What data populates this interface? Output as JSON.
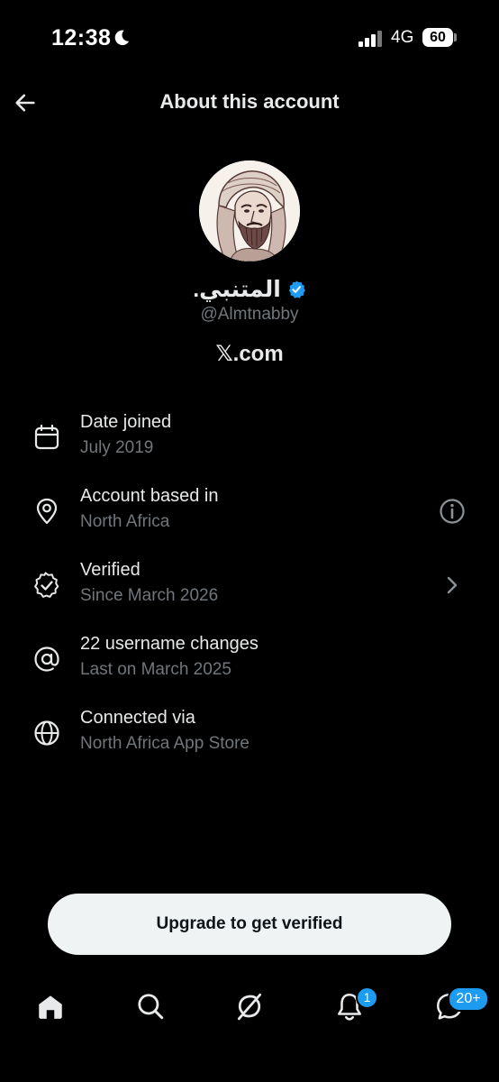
{
  "status_bar": {
    "time": "12:38",
    "network": "4G",
    "battery": "60"
  },
  "header": {
    "title": "About this account"
  },
  "profile": {
    "display_name": "المتنبي.",
    "handle": "@Almtnabby",
    "brand": "𝕏.com"
  },
  "info_rows": [
    {
      "icon": "calendar-icon",
      "title": "Date joined",
      "value": "July 2019"
    },
    {
      "icon": "location-pin-icon",
      "title": "Account based in",
      "value": "North Africa",
      "trailing": "info-icon"
    },
    {
      "icon": "verified-check-icon",
      "title": "Verified",
      "value": "Since March 2026",
      "trailing": "chevron-right-icon"
    },
    {
      "icon": "at-sign-icon",
      "title": "22 username changes",
      "value": "Last on March 2025"
    },
    {
      "icon": "globe-icon",
      "title": "Connected via",
      "value": "North Africa App Store"
    }
  ],
  "upgrade_button": {
    "label": "Upgrade to get verified"
  },
  "bottom_nav": {
    "items": [
      "home-icon",
      "search-icon",
      "grok-icon",
      "notifications-icon",
      "messages-icon"
    ],
    "notifications_badge": "1",
    "messages_badge": "20+"
  },
  "colors": {
    "background": "#000000",
    "primary_text": "#e7e9ea",
    "secondary_text": "#71767b",
    "accent": "#1d9bf0",
    "button_bg": "#eff3f4"
  }
}
